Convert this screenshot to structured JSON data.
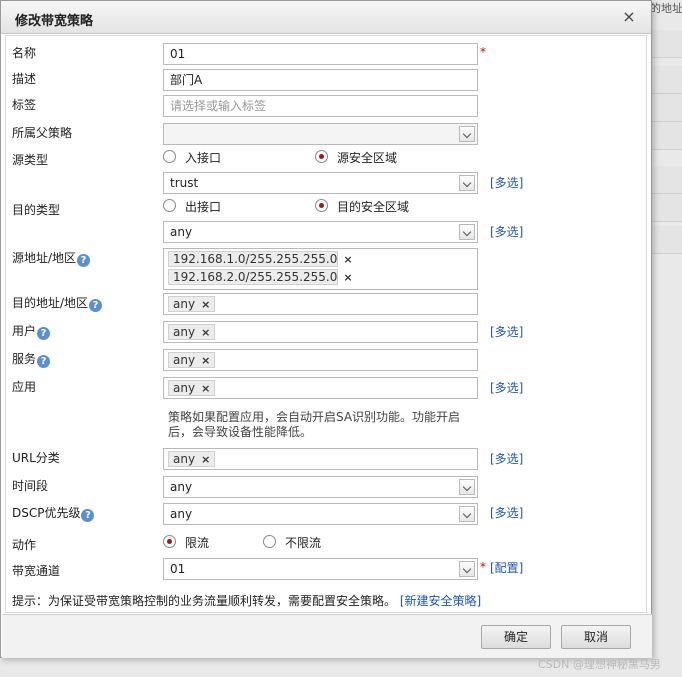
{
  "background": {
    "header_text": "的地址"
  },
  "dialog": {
    "title": "修改带宽策略",
    "close_icon": "×"
  },
  "form": {
    "name": {
      "label": "名称",
      "value": "01",
      "required": "*"
    },
    "description": {
      "label": "描述",
      "value": "部门A"
    },
    "tags": {
      "label": "标签",
      "placeholder": "请选择或输入标签"
    },
    "parent_policy": {
      "label": "所属父策略",
      "value": ""
    },
    "source_type": {
      "label": "源类型",
      "options": [
        "入接口",
        "源安全区域"
      ],
      "selected": "源安全区域",
      "select_value": "trust",
      "multi_link": "[多选]"
    },
    "dest_type": {
      "label": "目的类型",
      "options": [
        "出接口",
        "目的安全区域"
      ],
      "selected": "目的安全区域",
      "select_value": "any",
      "multi_link": "[多选]"
    },
    "source_address": {
      "label": "源地址/地区",
      "tags": [
        "192.168.1.0/255.255.255.0",
        "192.168.2.0/255.255.255.0"
      ]
    },
    "dest_address": {
      "label": "目的地址/地区",
      "tags": [
        "any"
      ]
    },
    "user": {
      "label": "用户",
      "tags": [
        "any"
      ],
      "multi_link": "[多选]"
    },
    "service": {
      "label": "服务",
      "tags": [
        "any"
      ]
    },
    "application": {
      "label": "应用",
      "tags": [
        "any"
      ],
      "multi_link": "[多选]",
      "note": "策略如果配置应用，会自动开启SA识别功能。功能开启后，会导致设备性能降低。"
    },
    "url_category": {
      "label": "URL分类",
      "tags": [
        "any"
      ],
      "multi_link": "[多选]"
    },
    "time_range": {
      "label": "时间段",
      "value": "any"
    },
    "dscp_priority": {
      "label": "DSCP优先级",
      "value": "any",
      "multi_link": "[多选]"
    },
    "action": {
      "label": "动作",
      "options": [
        "限流",
        "不限流"
      ],
      "selected": "限流"
    },
    "bandwidth_channel": {
      "label": "带宽通道",
      "value": "01",
      "required": "*",
      "config_link": "[配置]"
    },
    "hint": {
      "text": "提示：为保证受带宽策略控制的业务流量顺利转发，需要配置安全策略。",
      "link": "[新建安全策略]"
    }
  },
  "footer": {
    "ok_label": "确定",
    "cancel_label": "取消"
  },
  "watermark": "CSDN @理想神秘黑马男",
  "colors": {
    "link": "#1f56b8",
    "required": "#dd0000",
    "radio_on": "#a01818"
  }
}
